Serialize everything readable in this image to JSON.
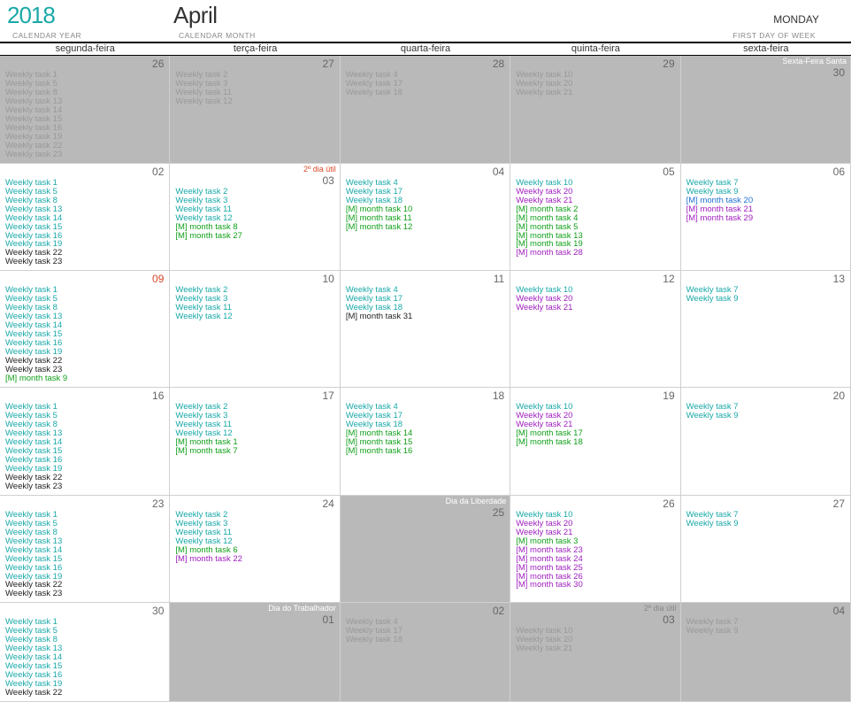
{
  "header": {
    "year": "2018",
    "year_label": "CALENDAR YEAR",
    "month": "April",
    "month_label": "CALENDAR MONTH",
    "fdow": "MONDAY",
    "fdow_label": "FIRST DAY OF WEEK"
  },
  "dow": [
    "segunda-feira",
    "terça-feira",
    "quarta-feira",
    "quinta-feira",
    "sexta-feira"
  ],
  "weeks": [
    {
      "days": [
        {
          "num": "26",
          "outside": true,
          "tasks": [
            {
              "t": "Weekly task 1",
              "c": "gray"
            },
            {
              "t": "Weekly task 5",
              "c": "gray"
            },
            {
              "t": "Weekly task 8",
              "c": "gray"
            },
            {
              "t": "Weekly task 13",
              "c": "gray"
            },
            {
              "t": "Weekly task 14",
              "c": "gray"
            },
            {
              "t": "Weekly task 15",
              "c": "gray"
            },
            {
              "t": "Weekly task 16",
              "c": "gray"
            },
            {
              "t": "Weekly task 19",
              "c": "gray"
            },
            {
              "t": "Weekly task 22",
              "c": "gray"
            },
            {
              "t": "Weekly task 23",
              "c": "gray"
            }
          ]
        },
        {
          "num": "27",
          "outside": true,
          "tasks": [
            {
              "t": "Weekly task 2",
              "c": "gray"
            },
            {
              "t": "Weekly task 3",
              "c": "gray"
            },
            {
              "t": "Weekly task 11",
              "c": "gray"
            },
            {
              "t": "Weekly task 12",
              "c": "gray"
            }
          ]
        },
        {
          "num": "28",
          "outside": true,
          "tasks": [
            {
              "t": "Weekly task 4",
              "c": "gray"
            },
            {
              "t": "Weekly task 17",
              "c": "gray"
            },
            {
              "t": "Weekly task 18",
              "c": "gray"
            }
          ]
        },
        {
          "num": "29",
          "outside": true,
          "tasks": [
            {
              "t": "Weekly task 10",
              "c": "gray"
            },
            {
              "t": "Weekly task 20",
              "c": "gray"
            },
            {
              "t": "Weekly task 21",
              "c": "gray"
            }
          ]
        },
        {
          "num": "30",
          "outside": true,
          "holiday": true,
          "note": "Sexta-Feira Santa",
          "note_c": "white",
          "tasks": []
        }
      ]
    },
    {
      "days": [
        {
          "num": "02",
          "tasks": [
            {
              "t": "Weekly task 1",
              "c": "teal"
            },
            {
              "t": "Weekly task 5",
              "c": "teal"
            },
            {
              "t": "Weekly task 8",
              "c": "teal"
            },
            {
              "t": "Weekly task 13",
              "c": "teal"
            },
            {
              "t": "Weekly task 14",
              "c": "teal"
            },
            {
              "t": "Weekly task 15",
              "c": "teal"
            },
            {
              "t": "Weekly task 16",
              "c": "teal"
            },
            {
              "t": "Weekly task 19",
              "c": "teal"
            },
            {
              "t": "Weekly task 22",
              "c": "black"
            },
            {
              "t": "Weekly task 23",
              "c": "black"
            }
          ]
        },
        {
          "num": "03",
          "note": "2º dia útil",
          "note_c": "red",
          "tasks": [
            {
              "t": "Weekly task 2",
              "c": "teal"
            },
            {
              "t": "Weekly task 3",
              "c": "teal"
            },
            {
              "t": "Weekly task 11",
              "c": "teal"
            },
            {
              "t": "Weekly task 12",
              "c": "teal"
            },
            {
              "t": "[M] month task 8",
              "c": "green"
            },
            {
              "t": "[M] month task 27",
              "c": "green"
            }
          ]
        },
        {
          "num": "04",
          "tasks": [
            {
              "t": "Weekly task 4",
              "c": "teal"
            },
            {
              "t": "Weekly task 17",
              "c": "teal"
            },
            {
              "t": "Weekly task 18",
              "c": "teal"
            },
            {
              "t": "[M] month task 10",
              "c": "green"
            },
            {
              "t": "[M] month task 11",
              "c": "green"
            },
            {
              "t": "[M] month task 12",
              "c": "green"
            }
          ]
        },
        {
          "num": "05",
          "tasks": [
            {
              "t": "Weekly task 10",
              "c": "teal"
            },
            {
              "t": "Weekly task 20",
              "c": "purple"
            },
            {
              "t": "Weekly task 21",
              "c": "purple"
            },
            {
              "t": "[M] month task 2",
              "c": "green"
            },
            {
              "t": "[M] month task 4",
              "c": "green"
            },
            {
              "t": "[M] month task 5",
              "c": "green"
            },
            {
              "t": "[M] month task 13",
              "c": "green"
            },
            {
              "t": "[M] month task 19",
              "c": "green"
            },
            {
              "t": "[M] month task 28",
              "c": "purple"
            }
          ]
        },
        {
          "num": "06",
          "tasks": [
            {
              "t": "Weekly task 7",
              "c": "teal"
            },
            {
              "t": "Weekly task 9",
              "c": "teal"
            },
            {
              "t": "[M] month task 20",
              "c": "blue"
            },
            {
              "t": "[M] month task 21",
              "c": "purple"
            },
            {
              "t": "[M] month task 29",
              "c": "purple"
            }
          ]
        }
      ]
    },
    {
      "days": [
        {
          "num": "09",
          "num_c": "red",
          "tasks": [
            {
              "t": "Weekly task 1",
              "c": "teal"
            },
            {
              "t": "Weekly task 5",
              "c": "teal"
            },
            {
              "t": "Weekly task 8",
              "c": "teal"
            },
            {
              "t": "Weekly task 13",
              "c": "teal"
            },
            {
              "t": "Weekly task 14",
              "c": "teal"
            },
            {
              "t": "Weekly task 15",
              "c": "teal"
            },
            {
              "t": "Weekly task 16",
              "c": "teal"
            },
            {
              "t": "Weekly task 19",
              "c": "teal"
            },
            {
              "t": "Weekly task 22",
              "c": "black"
            },
            {
              "t": "Weekly task 23",
              "c": "black"
            },
            {
              "t": "[M] month task 9",
              "c": "green"
            }
          ]
        },
        {
          "num": "10",
          "tasks": [
            {
              "t": "Weekly task 2",
              "c": "teal"
            },
            {
              "t": "Weekly task 3",
              "c": "teal"
            },
            {
              "t": "Weekly task 11",
              "c": "teal"
            },
            {
              "t": "Weekly task 12",
              "c": "teal"
            }
          ]
        },
        {
          "num": "11",
          "tasks": [
            {
              "t": "Weekly task 4",
              "c": "teal"
            },
            {
              "t": "Weekly task 17",
              "c": "teal"
            },
            {
              "t": "Weekly task 18",
              "c": "teal"
            },
            {
              "t": "[M] month task 31",
              "c": "black"
            }
          ]
        },
        {
          "num": "12",
          "tasks": [
            {
              "t": "Weekly task 10",
              "c": "teal"
            },
            {
              "t": "Weekly task 20",
              "c": "purple"
            },
            {
              "t": "Weekly task 21",
              "c": "purple"
            }
          ]
        },
        {
          "num": "13",
          "tasks": [
            {
              "t": "Weekly task 7",
              "c": "teal"
            },
            {
              "t": "Weekly task 9",
              "c": "teal"
            }
          ]
        }
      ]
    },
    {
      "days": [
        {
          "num": "16",
          "tasks": [
            {
              "t": "Weekly task 1",
              "c": "teal"
            },
            {
              "t": "Weekly task 5",
              "c": "teal"
            },
            {
              "t": "Weekly task 8",
              "c": "teal"
            },
            {
              "t": "Weekly task 13",
              "c": "teal"
            },
            {
              "t": "Weekly task 14",
              "c": "teal"
            },
            {
              "t": "Weekly task 15",
              "c": "teal"
            },
            {
              "t": "Weekly task 16",
              "c": "teal"
            },
            {
              "t": "Weekly task 19",
              "c": "teal"
            },
            {
              "t": "Weekly task 22",
              "c": "black"
            },
            {
              "t": "Weekly task 23",
              "c": "black"
            }
          ]
        },
        {
          "num": "17",
          "tasks": [
            {
              "t": "Weekly task 2",
              "c": "teal"
            },
            {
              "t": "Weekly task 3",
              "c": "teal"
            },
            {
              "t": "Weekly task 11",
              "c": "teal"
            },
            {
              "t": "Weekly task 12",
              "c": "teal"
            },
            {
              "t": "[M] month task 1",
              "c": "green"
            },
            {
              "t": "[M] month task 7",
              "c": "green"
            }
          ]
        },
        {
          "num": "18",
          "tasks": [
            {
              "t": "Weekly task 4",
              "c": "teal"
            },
            {
              "t": "Weekly task 17",
              "c": "teal"
            },
            {
              "t": "Weekly task 18",
              "c": "teal"
            },
            {
              "t": "[M] month task 14",
              "c": "green"
            },
            {
              "t": "[M] month task 15",
              "c": "green"
            },
            {
              "t": "[M] month task 16",
              "c": "green"
            }
          ]
        },
        {
          "num": "19",
          "tasks": [
            {
              "t": "Weekly task 10",
              "c": "teal"
            },
            {
              "t": "Weekly task 20",
              "c": "purple"
            },
            {
              "t": "Weekly task 21",
              "c": "purple"
            },
            {
              "t": "[M] month task 17",
              "c": "green"
            },
            {
              "t": "[M] month task 18",
              "c": "green"
            }
          ]
        },
        {
          "num": "20",
          "tasks": [
            {
              "t": "Weekly task 7",
              "c": "teal"
            },
            {
              "t": "Weekly task 9",
              "c": "teal"
            }
          ]
        }
      ]
    },
    {
      "days": [
        {
          "num": "23",
          "tasks": [
            {
              "t": "Weekly task 1",
              "c": "teal"
            },
            {
              "t": "Weekly task 5",
              "c": "teal"
            },
            {
              "t": "Weekly task 8",
              "c": "teal"
            },
            {
              "t": "Weekly task 13",
              "c": "teal"
            },
            {
              "t": "Weekly task 14",
              "c": "teal"
            },
            {
              "t": "Weekly task 15",
              "c": "teal"
            },
            {
              "t": "Weekly task 16",
              "c": "teal"
            },
            {
              "t": "Weekly task 19",
              "c": "teal"
            },
            {
              "t": "Weekly task 22",
              "c": "black"
            },
            {
              "t": "Weekly task 23",
              "c": "black"
            }
          ]
        },
        {
          "num": "24",
          "tasks": [
            {
              "t": "Weekly task 2",
              "c": "teal"
            },
            {
              "t": "Weekly task 3",
              "c": "teal"
            },
            {
              "t": "Weekly task 11",
              "c": "teal"
            },
            {
              "t": "Weekly task 12",
              "c": "teal"
            },
            {
              "t": "[M] month task 6",
              "c": "green"
            },
            {
              "t": "[M] month task 22",
              "c": "purple"
            }
          ]
        },
        {
          "num": "25",
          "holiday": true,
          "note": "Dia da Liberdade",
          "note_c": "white",
          "tasks": []
        },
        {
          "num": "26",
          "tasks": [
            {
              "t": "Weekly task 10",
              "c": "teal"
            },
            {
              "t": "Weekly task 20",
              "c": "purple"
            },
            {
              "t": "Weekly task 21",
              "c": "purple"
            },
            {
              "t": "[M] month task 3",
              "c": "green"
            },
            {
              "t": "[M] month task 23",
              "c": "purple"
            },
            {
              "t": "[M] month task 24",
              "c": "purple"
            },
            {
              "t": "[M] month task 25",
              "c": "purple"
            },
            {
              "t": "[M] month task 26",
              "c": "purple"
            },
            {
              "t": "[M] month task 30",
              "c": "purple"
            }
          ]
        },
        {
          "num": "27",
          "tasks": [
            {
              "t": "Weekly task 7",
              "c": "teal"
            },
            {
              "t": "Weekly task 9",
              "c": "teal"
            }
          ]
        }
      ]
    },
    {
      "days": [
        {
          "num": "30",
          "tasks": [
            {
              "t": "Weekly task 1",
              "c": "teal"
            },
            {
              "t": "Weekly task 5",
              "c": "teal"
            },
            {
              "t": "Weekly task 8",
              "c": "teal"
            },
            {
              "t": "Weekly task 13",
              "c": "teal"
            },
            {
              "t": "Weekly task 14",
              "c": "teal"
            },
            {
              "t": "Weekly task 15",
              "c": "teal"
            },
            {
              "t": "Weekly task 16",
              "c": "teal"
            },
            {
              "t": "Weekly task 19",
              "c": "teal"
            },
            {
              "t": "Weekly task 22",
              "c": "black"
            }
          ]
        },
        {
          "num": "01",
          "outside": true,
          "holiday": true,
          "note": "Dia do Trabalhador",
          "note_c": "white",
          "tasks": []
        },
        {
          "num": "02",
          "outside": true,
          "tasks": [
            {
              "t": "Weekly task 4",
              "c": "gray"
            },
            {
              "t": "Weekly task 17",
              "c": "gray"
            },
            {
              "t": "Weekly task 18",
              "c": "gray"
            }
          ]
        },
        {
          "num": "03",
          "outside": true,
          "note": "2º dia útil",
          "note_c": "gray",
          "tasks": [
            {
              "t": "Weekly task 10",
              "c": "gray"
            },
            {
              "t": "Weekly task 20",
              "c": "gray"
            },
            {
              "t": "Weekly task 21",
              "c": "gray"
            }
          ]
        },
        {
          "num": "04",
          "outside": true,
          "tasks": [
            {
              "t": "Weekly task 7",
              "c": "gray"
            },
            {
              "t": "Weekly task 9",
              "c": "gray"
            }
          ]
        }
      ]
    }
  ]
}
